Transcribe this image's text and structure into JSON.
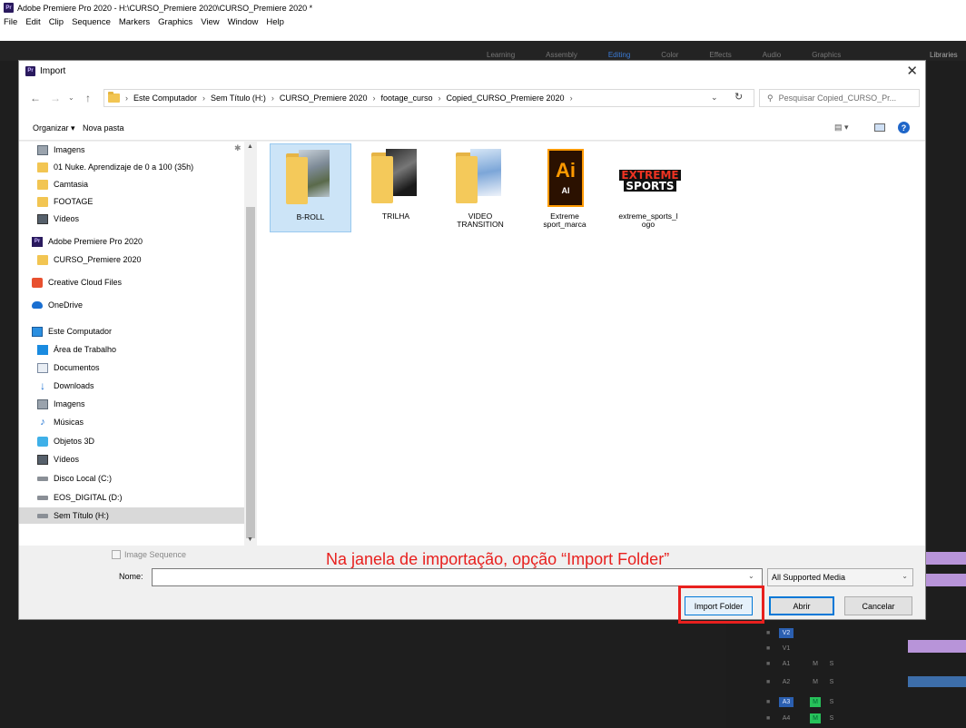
{
  "app": {
    "title": "Adobe Premiere Pro 2020 - H:\\CURSO_Premiere 2020\\CURSO_Premiere 2020 *",
    "badge": "Pr",
    "menu": [
      "File",
      "Edit",
      "Clip",
      "Sequence",
      "Markers",
      "Graphics",
      "View",
      "Window",
      "Help"
    ],
    "workspaces": [
      "Learning",
      "Assembly",
      "Editing",
      "Color",
      "Effects",
      "Audio",
      "Graphics"
    ],
    "libraries": "Libraries",
    "tracks": [
      "V2",
      "V1",
      "A1",
      "A2",
      "A3",
      "A4"
    ],
    "track_toggles": [
      "M",
      "S"
    ]
  },
  "dialog": {
    "title": "Import",
    "close": "✕",
    "address": {
      "crumbs": [
        "Este Computador",
        "Sem Título (H:)",
        "CURSO_Premiere 2020",
        "footage_curso",
        "Copied_CURSO_Premiere 2020"
      ]
    },
    "search": {
      "placeholder": "Pesquisar Copied_CURSO_Pr..."
    },
    "toolbar": {
      "organize": "Organizar ▾",
      "new_folder": "Nova pasta",
      "view": "▤ ▾",
      "help": "?"
    },
    "nav_items": [
      "Imagens",
      "01 Nuke. Aprendizaje de 0 a 100 (35h)",
      "Camtasia",
      "FOOTAGE",
      "Vídeos",
      "Adobe Premiere Pro 2020",
      "CURSO_Premiere 2020",
      "Creative Cloud Files",
      "OneDrive",
      "Este Computador",
      "Área de Trabalho",
      "Documentos",
      "Downloads",
      "Imagens",
      "Músicas",
      "Objetos 3D",
      "Vídeos",
      "Disco Local (C:)",
      "EOS_DIGITAL (D:)",
      "Sem Título (H:)"
    ],
    "files": [
      {
        "label": "B-ROLL"
      },
      {
        "label": "TRILHA"
      },
      {
        "label": "VIDEO\nTRANSITION"
      },
      {
        "label": "Extreme\nsport_marca",
        "icon_text": "Ai",
        "icon_sub": "AI"
      },
      {
        "label": "extreme_sports_l\nogo",
        "logo_top": "EXTREME",
        "logo_bottom": "SPORTS"
      }
    ],
    "image_sequence": "Image Sequence",
    "filename_label": "Nome:",
    "filename_value": "",
    "filetype": "All Supported Media",
    "buttons": {
      "import_folder": "Import Folder",
      "open": "Abrir",
      "cancel": "Cancelar"
    }
  },
  "annotation": {
    "text": "Na janela de importação, opção “Import Folder”",
    "color": "#e8201e"
  }
}
